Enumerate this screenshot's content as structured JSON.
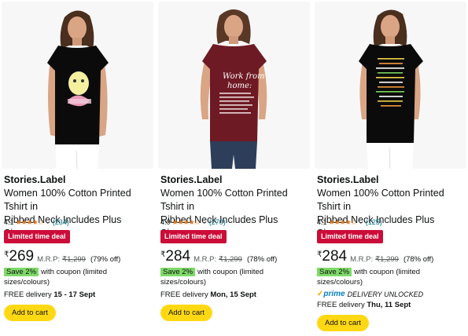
{
  "products": [
    {
      "brand": "Stories.Label",
      "title_line1": "Women 100% Cotton Printed Tshirt in",
      "title_line2": "Ribbed Neck Includes Plus Sizes,...",
      "rating": "4.1",
      "stars_icon": "star-rating-4-icon",
      "reviews": "(234)",
      "deal": "Limited time deal",
      "rupee": "₹",
      "price": "269",
      "mrp_label": "M.R.P:",
      "mrp": "₹1,299",
      "off": "(79% off)",
      "save": "Save 2%",
      "coupon_text": "with coupon (limited sizes/colours)",
      "prime": null,
      "delivery_prefix": "FREE delivery ",
      "delivery_date": "15 - 17 Sept",
      "add_to_cart": "Add to cart",
      "shirt_color": "#0b0b0b"
    },
    {
      "brand": "Stories.Label",
      "title_line1": "Women 100% Cotton Printed Tshirt in",
      "title_line2": "Ribbed Neck Includes Plus Sizes,...",
      "rating": "4.0",
      "stars_icon": "star-rating-4-icon",
      "reviews": "(270)",
      "deal": "Limited time deal",
      "rupee": "₹",
      "price": "284",
      "mrp_label": "M.R.P:",
      "mrp": "₹1,299",
      "off": "(78% off)",
      "save": "Save 2%",
      "coupon_text": "with coupon (limited sizes/colours)",
      "prime": null,
      "delivery_prefix": "FREE delivery ",
      "delivery_date": "Mon, 15 Sept",
      "add_to_cart": "Add to cart",
      "shirt_color": "#6e1a24",
      "print_text_1": "Work from",
      "print_text_2": "home:"
    },
    {
      "brand": "Stories.Label",
      "title_line1": "Women 100% Cotton Printed Tshirt in",
      "title_line2": "Ribbed Neck Includes Plus Sizes,...",
      "rating": "4.1",
      "stars_icon": "star-rating-4-icon",
      "reviews": "(125)",
      "deal": "Limited time deal",
      "rupee": "₹",
      "price": "284",
      "mrp_label": "M.R.P:",
      "mrp": "₹1,299",
      "off": "(78% off)",
      "save": "Save 2%",
      "coupon_text": "with coupon (limited sizes/colours)",
      "prime": {
        "logo": "prime",
        "text": "DELIVERY UNLOCKED"
      },
      "delivery_prefix": "FREE delivery ",
      "delivery_date": "Thu, 11 Sept",
      "add_to_cart": "Add to cart",
      "shirt_color": "#0b0b0b"
    }
  ],
  "colors": {
    "deal_red": "#cc0c39",
    "save_green": "#7fda69",
    "cart_yellow": "#ffd814",
    "link_teal": "#007185",
    "star_orange": "#de7921",
    "prime_blue": "#0a7ec2"
  }
}
